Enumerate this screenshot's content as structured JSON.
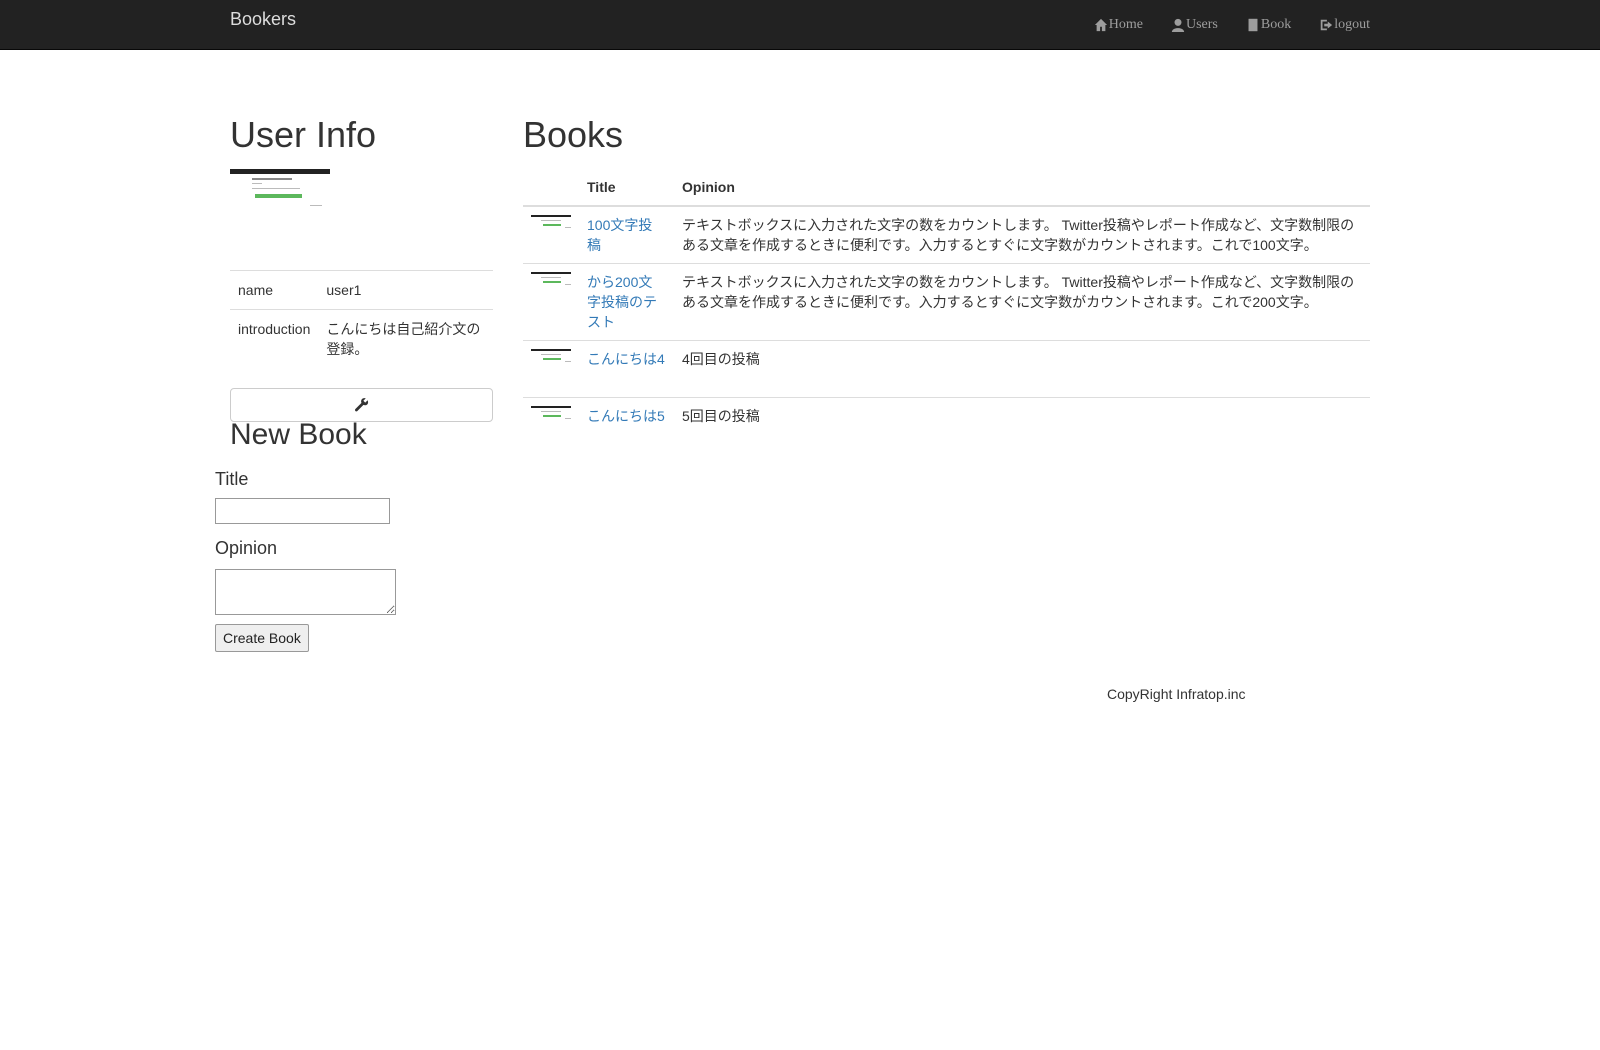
{
  "navbar": {
    "brand": "Bookers",
    "items": [
      {
        "label": "Home",
        "icon": "home-icon"
      },
      {
        "label": "Users",
        "icon": "user-icon"
      },
      {
        "label": "Book",
        "icon": "book-icon"
      },
      {
        "label": "logout",
        "icon": "logout-icon"
      }
    ]
  },
  "user_info": {
    "heading": "User Info",
    "rows": [
      {
        "key": "name",
        "value": "user1"
      },
      {
        "key": "introduction",
        "value": "こんにちは自己紹介文の登録。"
      }
    ],
    "edit_icon": "wrench-icon"
  },
  "new_book": {
    "heading": "New Book",
    "title_label": "Title",
    "title_value": "",
    "opinion_label": "Opinion",
    "opinion_value": "",
    "submit_label": "Create Book"
  },
  "books": {
    "heading": "Books",
    "columns": [
      "Title",
      "Opinion"
    ],
    "rows": [
      {
        "title": "100文字投稿",
        "opinion": "テキストボックスに入力された文字の数をカウントします。 Twitter投稿やレポート作成など、文字数制限のある文章を作成するときに便利です。入力するとすぐに文字数がカウントされます。これで100文字。"
      },
      {
        "title": "から200文字投稿のテスト",
        "opinion": "テキストボックスに入力された文字の数をカウントします。 Twitter投稿やレポート作成など、文字数制限のある文章を作成するときに便利です。入力するとすぐに文字数がカウントされます。これで200文字。"
      },
      {
        "title": "こんにちは4",
        "opinion": "4回目の投稿"
      },
      {
        "title": "こんにちは5",
        "opinion": "5回目の投稿"
      }
    ]
  },
  "footer": {
    "text": "CopyRight Infratop.inc"
  },
  "colors": {
    "navbar_bg": "#222222",
    "link": "#337ab7",
    "thumb_accent": "#5cb85c"
  }
}
